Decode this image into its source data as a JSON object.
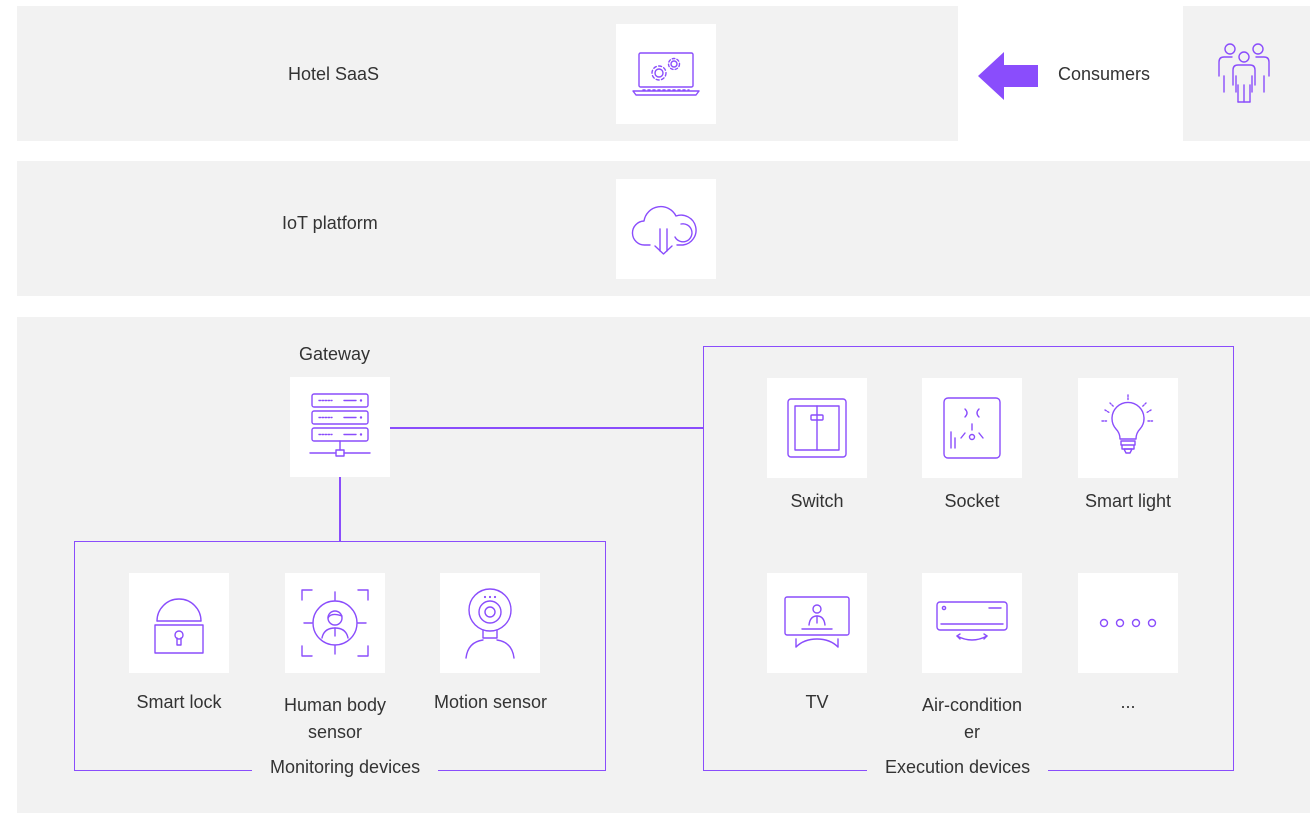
{
  "layers": {
    "saas": {
      "label": "Hotel SaaS",
      "icon": "laptop-gears-icon"
    },
    "iot": {
      "label": "IoT platform",
      "icon": "cloud-download-icon"
    }
  },
  "consumers": {
    "label": "Consumers",
    "icon": "people-group-icon",
    "arrow_icon": "arrow-left-icon"
  },
  "gateway": {
    "label": "Gateway",
    "icon": "server-rack-icon"
  },
  "monitoring": {
    "caption": "Monitoring devices",
    "devices": [
      {
        "label": "Smart lock",
        "icon": "padlock-icon"
      },
      {
        "label": "Human body sensor",
        "icon": "face-scan-icon"
      },
      {
        "label": "Motion sensor",
        "icon": "webcam-icon"
      }
    ]
  },
  "execution": {
    "caption": "Execution devices",
    "devices": [
      {
        "label": "Switch",
        "icon": "wall-switch-icon"
      },
      {
        "label": "Socket",
        "icon": "power-socket-icon"
      },
      {
        "label": "Smart light",
        "icon": "light-bulb-icon"
      },
      {
        "label": "TV",
        "icon": "television-icon"
      },
      {
        "label": "Air-conditioner",
        "icon": "air-conditioner-icon"
      },
      {
        "label": "...",
        "icon": "more-dots-icon"
      }
    ]
  },
  "colors": {
    "accent": "#8a4dfc",
    "band": "#f2f2f2",
    "text": "#333333"
  }
}
